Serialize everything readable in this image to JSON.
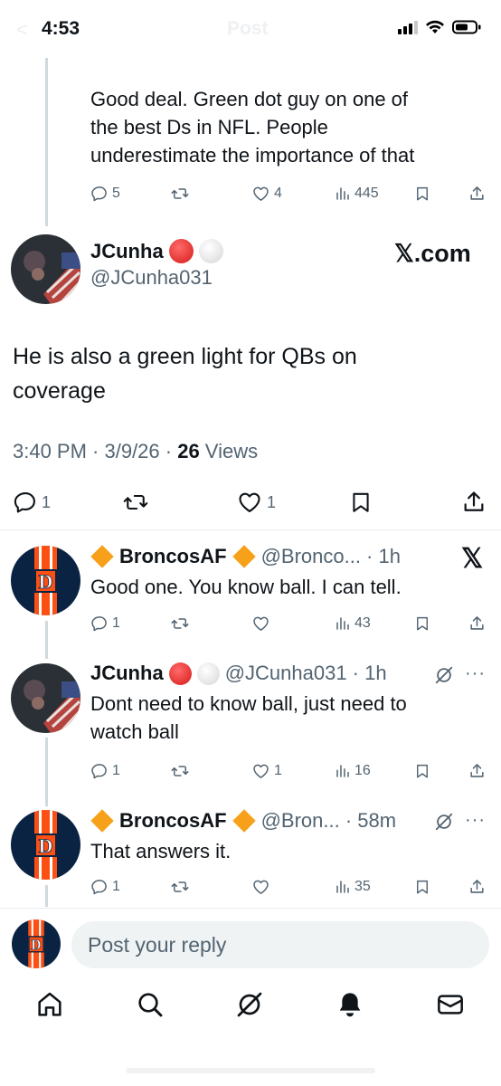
{
  "status_bar": {
    "time": "4:53",
    "ghost_back": "<",
    "ghost_title": "Post"
  },
  "prev_reply": {
    "text_lines": [
      "Good deal. Green dot guy on one of",
      "the best Ds in NFL. People",
      "underestimate the importance of that"
    ],
    "replies": "5",
    "likes": "4",
    "views": "445"
  },
  "main_tweet": {
    "name": "JCunha",
    "handle": "@JCunha031",
    "watermark": "𝕏.com",
    "text_lines": [
      "He is also a green light for QBs on",
      "coverage"
    ],
    "time": "3:40 PM · 3/9/26 · ",
    "views_count": "26",
    "views_label": " Views",
    "replies": "1",
    "likes": "1"
  },
  "replies": [
    {
      "name": "BroncosAF",
      "meta": "@Bronco... · 1h",
      "text_lines": [
        "Good one. You know ball. I can tell."
      ],
      "replies": "1",
      "retweets": "",
      "likes": "",
      "views": "43"
    },
    {
      "name": "JCunha",
      "meta": "@JCunha031 · 1h",
      "text_lines": [
        "Dont need to know ball, just need to",
        "watch ball"
      ],
      "replies": "1",
      "retweets": "",
      "likes": "1",
      "views": "16"
    },
    {
      "name": "BroncosAF",
      "meta": "@Bron... · 58m",
      "text_lines": [
        "That answers it."
      ],
      "replies": "1",
      "retweets": "",
      "likes": "",
      "views": "35"
    }
  ],
  "composer": {
    "placeholder": "Post your reply"
  },
  "colors": {
    "text": "#0f1419",
    "secondary": "#536471",
    "line": "#cfd9de",
    "broncos_navy": "#0a2343",
    "broncos_orange": "#fb4f14"
  },
  "icons": [
    "reply-icon",
    "retweet-icon",
    "like-icon",
    "views-icon",
    "bookmark-icon",
    "share-icon",
    "grok-icon",
    "more-icon",
    "x-logo-icon",
    "home-icon",
    "search-icon",
    "bell-icon",
    "mail-icon"
  ]
}
